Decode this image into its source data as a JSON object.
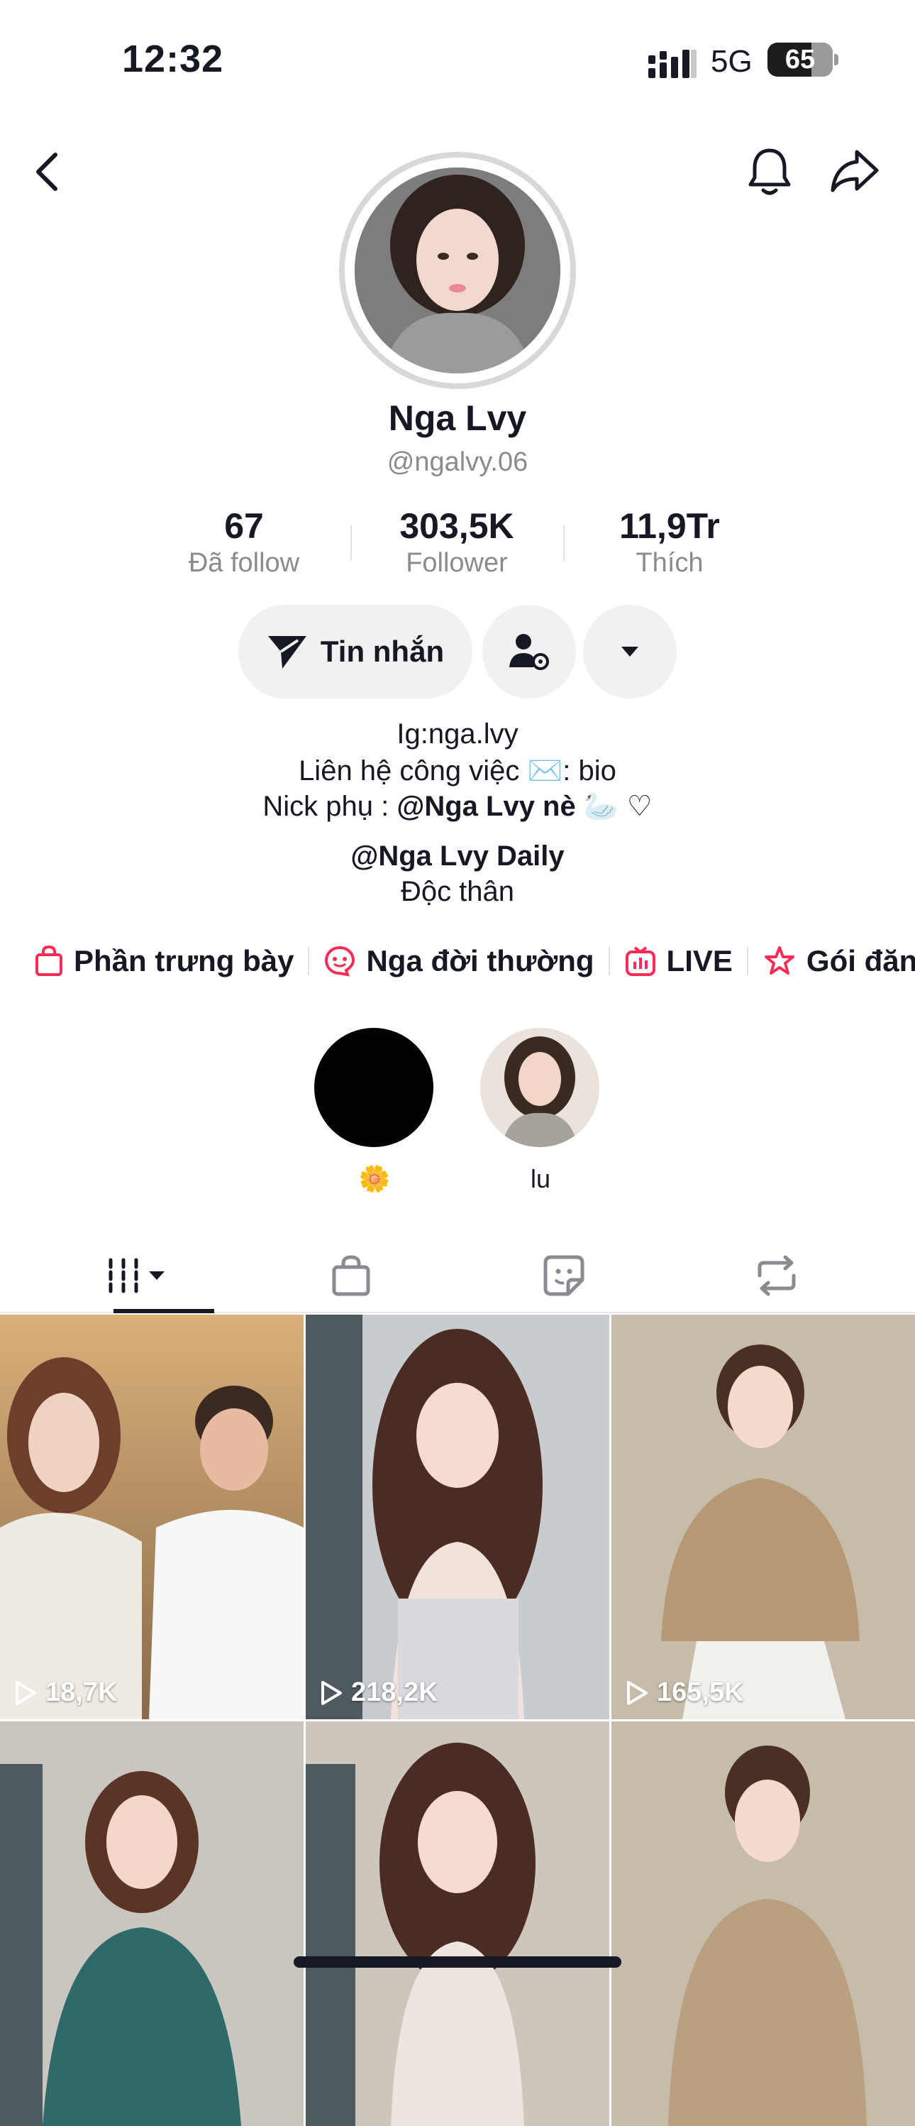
{
  "status_bar": {
    "time": "12:32",
    "network": "5G",
    "battery": "65"
  },
  "profile": {
    "name": "Nga Lvy",
    "handle": "@ngalvy.06",
    "stats": [
      {
        "value": "67",
        "label": "Đã follow"
      },
      {
        "value": "303,5K",
        "label": "Follower"
      },
      {
        "value": "11,9Tr",
        "label": "Thích"
      }
    ],
    "message_button": "Tin nhắn",
    "bio": {
      "line1": "Ig:nga.lvy",
      "line2": "Liên hệ công việc ✉️: bio",
      "line3_prefix": "Nick phụ : ",
      "line3_mention": "@Nga Lvy nè",
      "line3_suffix": " 🦢 ♡",
      "line4": "@Nga Lvy Daily",
      "line5": "Độc thân"
    }
  },
  "quick_links": [
    {
      "label": "Phần trưng bày",
      "icon": "shopping-bag-icon"
    },
    {
      "label": "Nga đời thường",
      "icon": "smiley-bubble-icon"
    },
    {
      "label": "LIVE",
      "icon": "live-tv-icon"
    },
    {
      "label": "Gói đăn",
      "icon": "subscription-star-icon"
    }
  ],
  "highlights": [
    {
      "label": "🌼"
    },
    {
      "label": "lu"
    }
  ],
  "tabs": [
    "videos-tab",
    "shop-tab",
    "reposts-liked-tab",
    "repost-tab"
  ],
  "videos": [
    {
      "views": "18,7K"
    },
    {
      "views": "218,2K"
    },
    {
      "views": "165,5K"
    },
    {
      "views": ""
    },
    {
      "views": ""
    },
    {
      "views": ""
    }
  ],
  "colors": {
    "accent": "#fe2c55",
    "text": "#161823",
    "muted": "#8a8b91",
    "button_bg": "#f1f1f2"
  }
}
